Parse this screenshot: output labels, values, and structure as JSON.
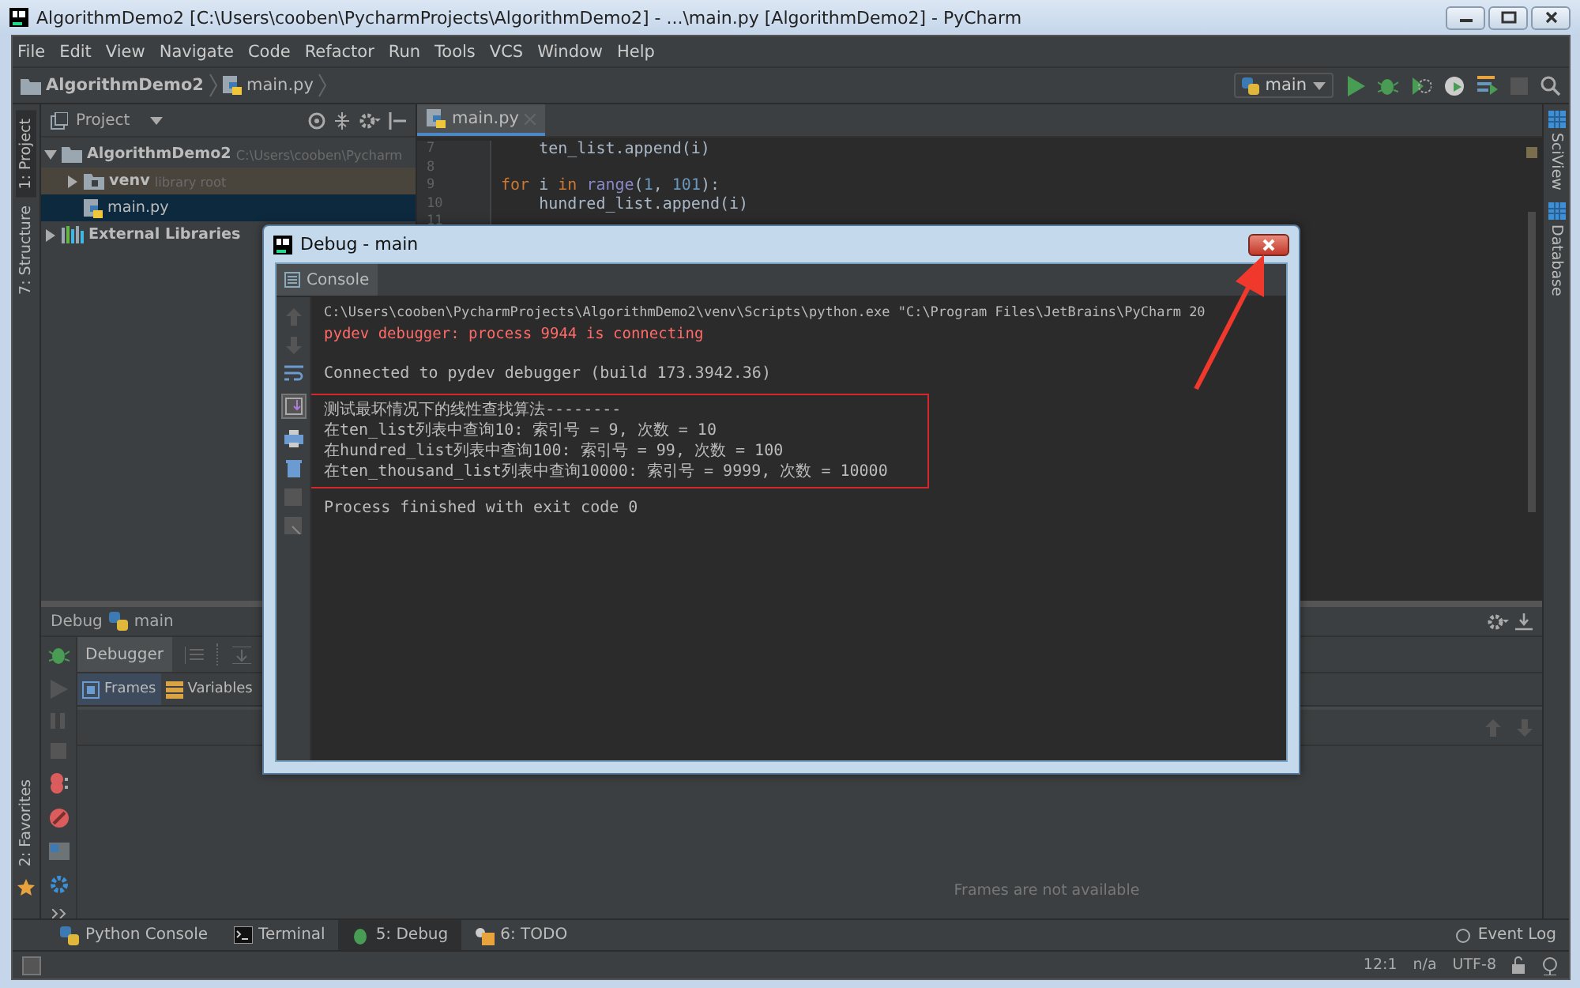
{
  "window": {
    "title": "AlgorithmDemo2 [C:\\Users\\cooben\\PycharmProjects\\AlgorithmDemo2] - ...\\main.py [AlgorithmDemo2] - PyCharm"
  },
  "menu": [
    "File",
    "Edit",
    "View",
    "Navigate",
    "Code",
    "Refactor",
    "Run",
    "Tools",
    "VCS",
    "Window",
    "Help"
  ],
  "breadcrumb": [
    "AlgorithmDemo2",
    "main.py"
  ],
  "run_config": "main",
  "left_strip": [
    {
      "label": "1: Project",
      "selected": true
    },
    {
      "label": "7: Structure",
      "selected": false
    }
  ],
  "favorites": "2: Favorites",
  "project_panel": {
    "title": "Project",
    "tree": [
      {
        "label": "AlgorithmDemo2",
        "hint": "C:\\Users\\cooben\\Pycharm",
        "kind": "project",
        "expanded": true,
        "selected": false,
        "children": [
          {
            "label": "venv",
            "hint": "library root",
            "kind": "library",
            "expanded": false,
            "selected": false
          },
          {
            "label": "main.py",
            "kind": "file",
            "selected": true
          }
        ]
      },
      {
        "label": "External Libraries",
        "kind": "libraries",
        "expanded": false,
        "selected": false
      }
    ]
  },
  "editor": {
    "tabs": [
      {
        "label": "main.py",
        "selected": true
      }
    ],
    "lines": [
      {
        "number": "7",
        "tokens": [
          {
            "kind": "plain",
            "text": "    ten_list.append(i)"
          }
        ]
      },
      {
        "number": "8"
      },
      {
        "number": "9",
        "tokens": [
          {
            "kind": "keyword",
            "text": "for"
          },
          {
            "kind": "plain",
            "text": " i "
          },
          {
            "kind": "keyword",
            "text": "in"
          },
          {
            "kind": "builtin",
            "text": " range"
          },
          {
            "kind": "plain",
            "text": "("
          },
          {
            "kind": "number",
            "text": "1"
          },
          {
            "kind": "plain",
            "text": ", "
          },
          {
            "kind": "number",
            "text": "101"
          },
          {
            "kind": "plain",
            "text": "):"
          }
        ]
      },
      {
        "number": "10",
        "tokens": [
          {
            "kind": "plain",
            "text": "    hundred_list.append(i)"
          }
        ]
      },
      {
        "number": "11"
      }
    ]
  },
  "right_strip": [
    "SciView",
    "Database"
  ],
  "debug_panel": {
    "title": "Debug",
    "config": "main",
    "tabs": [
      {
        "label": "Debugger",
        "selected": true
      }
    ],
    "subtabs": [
      {
        "label": "Frames",
        "selected": true
      },
      {
        "label": "Variables",
        "selected": false
      }
    ],
    "empty_message": "Frames are not available"
  },
  "bottom_tabs": [
    {
      "label": "Python Console",
      "kind": "python",
      "selected": false
    },
    {
      "label": "Terminal",
      "kind": "terminal",
      "selected": false
    },
    {
      "label": "5: Debug",
      "kind": "debug",
      "selected": true
    },
    {
      "label": "6: TODO",
      "kind": "todo",
      "selected": false
    }
  ],
  "event_log": "Event Log",
  "status_bar": [
    "12:1",
    "n/a",
    "UTF-8"
  ],
  "dialog": {
    "title": "Debug - main",
    "tabs": [
      {
        "label": "Console",
        "selected": true
      }
    ],
    "blocks": [
      {
        "highlighted": false,
        "lines": [
          {
            "kind": "command",
            "text": "C:\\Users\\cooben\\PycharmProjects\\AlgorithmDemo2\\venv\\Scripts\\python.exe \"C:\\Program Files\\JetBrains\\PyCharm 20"
          },
          {
            "kind": "error",
            "text": "pydev debugger: process 9944 is connecting"
          },
          {
            "kind": "blank"
          },
          {
            "kind": "output",
            "text": "Connected to pydev debugger (build 173.3942.36)"
          }
        ]
      },
      {
        "highlighted": true,
        "lines": [
          {
            "kind": "output",
            "text": "测试最坏情况下的线性查找算法--------"
          },
          {
            "kind": "output",
            "text": "在ten_list列表中查询10: 索引号 = 9, 次数 = 10"
          },
          {
            "kind": "output",
            "text": "在hundred_list列表中查询100: 索引号 = 99, 次数 = 100"
          },
          {
            "kind": "output",
            "text": "在ten_thousand_list列表中查询10000: 索引号 = 9999, 次数 = 10000"
          }
        ]
      },
      {
        "highlighted": false,
        "lines": [
          {
            "kind": "output",
            "text": "Process finished with exit code 0"
          }
        ]
      }
    ]
  },
  "annotations": [
    {
      "kind": "arrow"
    }
  ]
}
